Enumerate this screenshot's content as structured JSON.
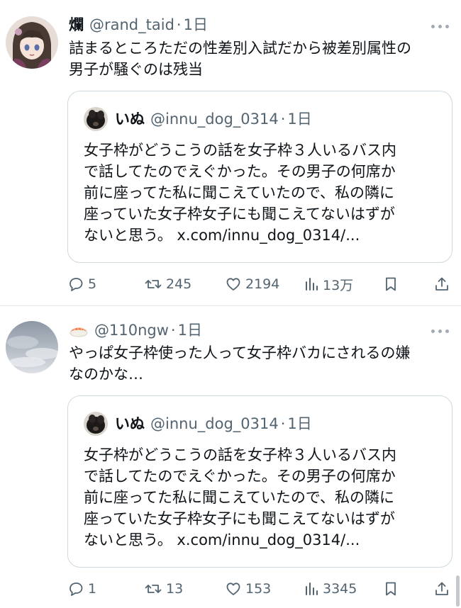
{
  "colors": {
    "text": "#0f1419",
    "muted": "#536471",
    "border": "#cfd9de"
  },
  "tweets": [
    {
      "display_name": "爛",
      "handle": "@rand_taid",
      "dot": "·",
      "time": "1日",
      "avatar_icon": "anime-avatar",
      "text_lines": [
        "詰まるところただの性差別入試だから被差別属性の",
        "男子が騒ぐのは残当"
      ],
      "quote": {
        "display_name": "いぬ",
        "handle": "@innu_dog_0314",
        "dot": "·",
        "time": "1日",
        "text_lines": [
          "女子枠がどうこうの話を女子枠３人いるバス内",
          "で話してたのでえぐかった。その男子の何席か",
          "前に座ってた私に聞こえていたので、私の隣に",
          "座っていた女子枠女子にも聞こえてないはずが",
          "ないと思う。 x.com/innu_dog_0314/..."
        ]
      },
      "actions": {
        "replies": "5",
        "retweets": "245",
        "likes": "2194",
        "views": "13万"
      }
    },
    {
      "display_name": "🍣",
      "handle": "@110ngw",
      "dot": "·",
      "time": "1日",
      "avatar_icon": "sky-avatar",
      "text_lines": [
        "やっぱ女子枠使った人って女子枠バカにされるの嫌",
        "なのかな…"
      ],
      "quote": {
        "display_name": "いぬ",
        "handle": "@innu_dog_0314",
        "dot": "·",
        "time": "1日",
        "text_lines": [
          "女子枠がどうこうの話を女子枠３人いるバス内",
          "で話してたのでえぐかった。その男子の何席か",
          "前に座ってた私に聞こえていたので、私の隣に",
          "座っていた女子枠女子にも聞こえてないはずが",
          "ないと思う。 x.com/innu_dog_0314/..."
        ]
      },
      "actions": {
        "replies": "1",
        "retweets": "13",
        "likes": "153",
        "views": "3345"
      }
    }
  ]
}
